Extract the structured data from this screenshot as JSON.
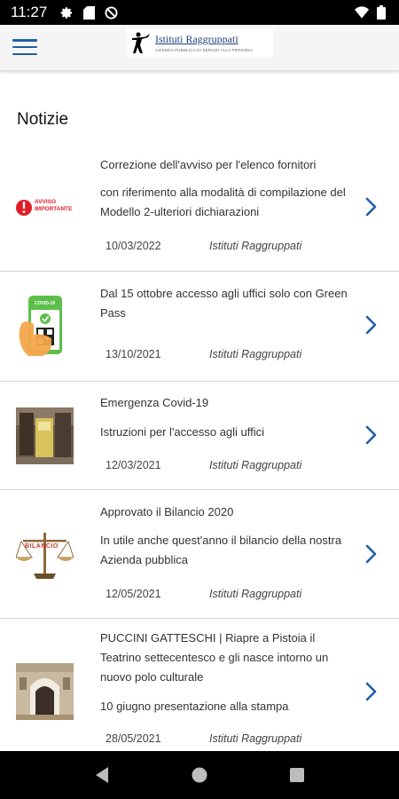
{
  "status_bar": {
    "time": "11:27",
    "icons_left": [
      "gear-icon",
      "sd-card-icon",
      "do-not-disturb-icon"
    ],
    "icons_right": [
      "wifi-icon",
      "battery-icon"
    ]
  },
  "header": {
    "menu_icon": "hamburger-menu-icon",
    "logo_title": "Istituti Raggruppati",
    "logo_subtitle": "AZIENDA PUBBLICA DI SERVIZI ALLA PERSONA"
  },
  "page": {
    "title": "Notizie"
  },
  "news": [
    {
      "thumb": "avviso-importante",
      "thumb_text": "AVVISO IMPORTANTE",
      "title": "Correzione dell'avviso per l'elenco fornitori",
      "subtitle": "con riferimento alla modalità di compilazione del Modello 2-ulteriori dichiarazioni",
      "date": "10/03/2022",
      "source": "Istituti Raggruppati"
    },
    {
      "thumb": "green-pass-phone",
      "thumb_text": "COVID-19",
      "title": "Dal 15 ottobre accesso agli uffici solo con Green Pass",
      "subtitle": "",
      "date": "13/10/2021",
      "source": "Istituti Raggruppati"
    },
    {
      "thumb": "office-photo",
      "title": "Emergenza Covid-19",
      "subtitle": "Istruzioni per l'accesso agli uffici",
      "date": "12/03/2021",
      "source": "Istituti Raggruppati"
    },
    {
      "thumb": "scales-bilancio",
      "thumb_text": "BILANCIO",
      "title": "Approvato il Bilancio 2020",
      "subtitle": "In utile anche quest'anno il bilancio della nostra Azienda pubblica",
      "date": "12/05/2021",
      "source": "Istituti Raggruppati"
    },
    {
      "thumb": "theater-photo",
      "title": "PUCCINI GATTESCHI | Riapre a Pistoia il Teatrino settecentesco e gli nasce intorno un nuovo polo culturale",
      "subtitle": "10 giugno presentazione alla stampa",
      "date": "28/05/2021",
      "source": "Istituti Raggruppati"
    }
  ],
  "nav_bar": {
    "back": "back-icon",
    "home": "home-icon",
    "recents": "recents-icon"
  },
  "colors": {
    "accent": "#1f5fa8",
    "divider": "#d6d6d6",
    "status_bar": "#000000",
    "app_bar": "#f5f5f5"
  }
}
